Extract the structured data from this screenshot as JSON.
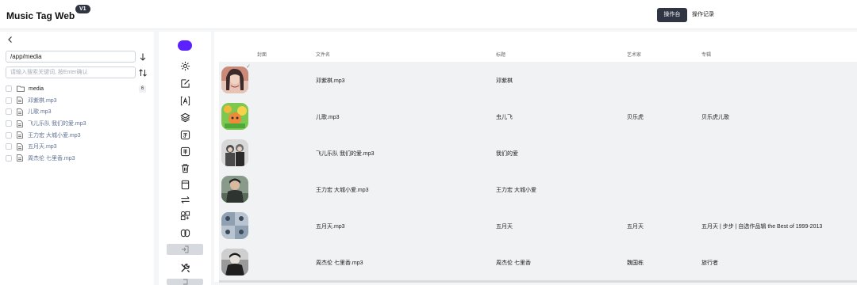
{
  "header": {
    "app_title": "Music Tag Web",
    "version": "V1",
    "nav": {
      "console": "操作台",
      "history": "操作记录"
    }
  },
  "sidebar": {
    "path_value": "/app/media",
    "search_placeholder": "请输入搜索关键词, 按Enter确认",
    "folder": {
      "name": "media",
      "count": "6"
    },
    "files": [
      "邓紫棋.mp3",
      "儿歌.mp3",
      "飞儿乐队 我们的爱.mp3",
      "王力宏 大城小爱.mp3",
      "五月天.mp3",
      "周杰伦 七里香.mp3"
    ]
  },
  "toolbar": {
    "icons": [
      "record-icon",
      "settings-icon",
      "edit-icon",
      "text-format-icon",
      "layers-icon",
      "convert-icon",
      "translate-icon",
      "delete-icon",
      "archive-icon",
      "swap-icon",
      "group-icon",
      "link-icon",
      "import-icon",
      "tools-icon",
      "export-icon"
    ]
  },
  "table": {
    "columns": {
      "cover": "封面",
      "filename": "文件名",
      "title": "标题",
      "artist": "艺术家",
      "album": "专辑"
    },
    "rows": [
      {
        "filename": "邓紫棋.mp3",
        "title": "邓紫棋",
        "artist": "",
        "album": "",
        "cover_colors": [
          "#c98a7a",
          "#3d2a2a"
        ]
      },
      {
        "filename": "儿歌.mp3",
        "title": "虫儿飞",
        "artist": "贝乐虎",
        "album": "贝乐虎儿歌",
        "cover_colors": [
          "#7ec850",
          "#f0b93a"
        ]
      },
      {
        "filename": "飞儿乐队 我们的爱.mp3",
        "title": "我们的爱",
        "artist": "",
        "album": "",
        "cover_colors": [
          "#d8d8d8",
          "#4a4a4a"
        ]
      },
      {
        "filename": "王力宏 大城小爱.mp3",
        "title": "王力宏 大城小爱",
        "artist": "",
        "album": "",
        "cover_colors": [
          "#8a9a8a",
          "#2e3530"
        ]
      },
      {
        "filename": "五月天.mp3",
        "title": "五月天",
        "artist": "五月天",
        "album": "五月天 | 步步 | 自选作品辑 the Best of 1999-2013",
        "cover_colors": [
          "#b9c4d0",
          "#3b4a5a"
        ]
      },
      {
        "filename": "周杰伦 七里香.mp3",
        "title": "周杰伦 七里香",
        "artist": "魏国栋",
        "album": "旅行者",
        "cover_colors": [
          "#9a9a9a",
          "#1e1e1e"
        ]
      }
    ]
  },
  "colors": {
    "accent": "#5b21ff",
    "dark": "#2f3542",
    "link": "#5e7193"
  }
}
